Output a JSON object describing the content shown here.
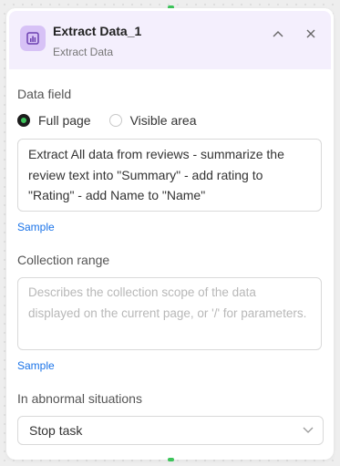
{
  "node": {
    "title": "Extract Data_1",
    "subtitle": "Extract Data",
    "icon": "chart-bar-icon",
    "accent": "#d7c2f6"
  },
  "data_field": {
    "label": "Data field",
    "options": [
      "Full page",
      "Visible area"
    ],
    "selected": "Full page",
    "value": "Extract All data from reviews - summarize the review text into \"Summary\" - add rating to \"Rating\" - add Name to \"Name\"",
    "sample_link": "Sample"
  },
  "collection_range": {
    "label": "Collection range",
    "placeholder": "Describes the collection scope of the data displayed on the current page, or '/' for parameters.",
    "sample_link": "Sample"
  },
  "abnormal": {
    "label": "In abnormal situations",
    "selected": "Stop task"
  },
  "colors": {
    "connector": "#3dc45b",
    "link": "#1a73e8",
    "header_bg": "#f4effd"
  }
}
